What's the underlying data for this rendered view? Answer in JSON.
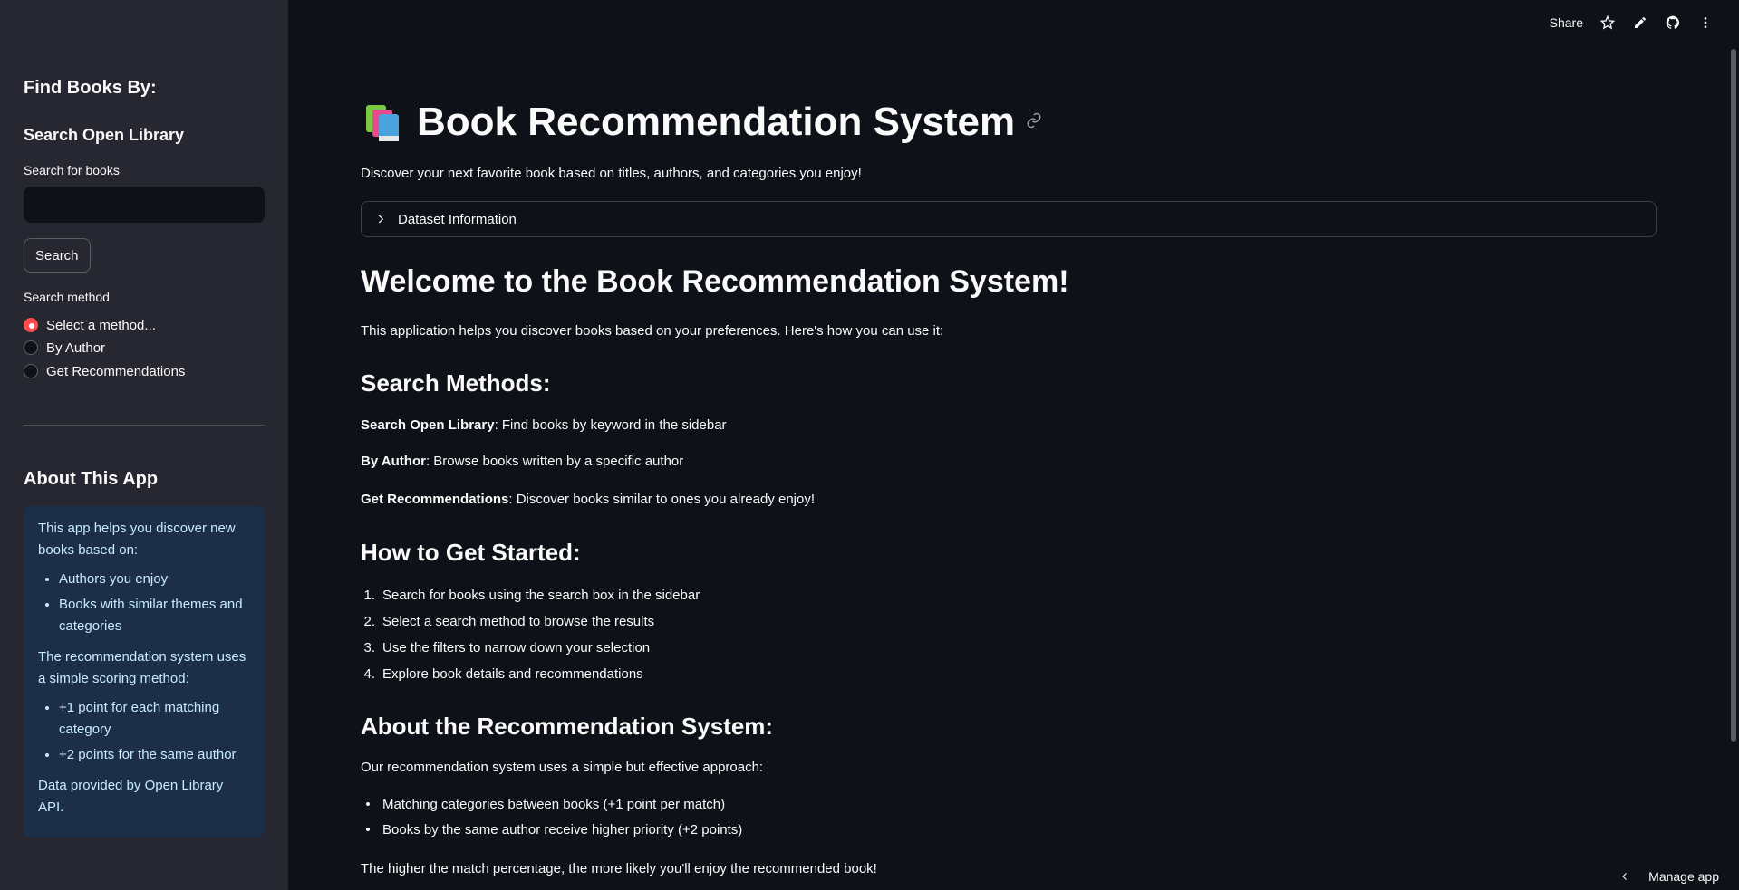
{
  "sidebar": {
    "heading": "Find Books By:",
    "search_heading": "Search Open Library",
    "search_label": "Search for books",
    "search_value": "",
    "search_button": "Search",
    "method_label": "Search method",
    "methods": [
      {
        "label": "Select a method...",
        "checked": true
      },
      {
        "label": "By Author",
        "checked": false
      },
      {
        "label": "Get Recommendations",
        "checked": false
      }
    ],
    "about_heading": "About This App",
    "about": {
      "intro": "This app helps you discover new books based on:",
      "bullets1": [
        "Authors you enjoy",
        "Books with similar themes and categories"
      ],
      "scoring": "The recommendation system uses a simple scoring method:",
      "bullets2": [
        "+1 point for each matching category",
        "+2 points for the same author"
      ],
      "footer": "Data provided by Open Library API."
    }
  },
  "toolbar": {
    "share": "Share",
    "icons": [
      "star-icon",
      "edit-icon",
      "github-icon",
      "more-icon"
    ]
  },
  "main": {
    "title": "Book Recommendation System",
    "subtitle": "Discover your next favorite book based on titles, authors, and categories you enjoy!",
    "expander": "Dataset Information",
    "welcome": "Welcome to the Book Recommendation System!",
    "welcome_text": "This application helps you discover books based on your preferences. Here's how you can use it:",
    "methods_heading": "Search Methods:",
    "methods": [
      {
        "bold": "Search Open Library",
        "rest": ": Find books by keyword in the sidebar"
      },
      {
        "bold": "By Author",
        "rest": ": Browse books written by a specific author"
      },
      {
        "bold": "Get Recommendations",
        "rest": ": Discover books similar to ones you already enjoy!"
      }
    ],
    "started_heading": "How to Get Started:",
    "steps": [
      "Search for books using the search box in the sidebar",
      "Select a search method to browse the results",
      "Use the filters to narrow down your selection",
      "Explore book details and recommendations"
    ],
    "about_heading": "About the Recommendation System:",
    "about_text": "Our recommendation system uses a simple but effective approach:",
    "about_bullets": [
      "Matching categories between books (+1 point per match)",
      "Books by the same author receive higher priority (+2 points)"
    ],
    "closing": "The higher the match percentage, the more likely you'll enjoy the recommended book!"
  },
  "manage_app": "Manage app",
  "colors": {
    "background": "#0e1117",
    "sidebar": "#262730",
    "accent": "#ff4b4b",
    "info_bg": "#1d2f47",
    "info_text": "#c7ebff"
  }
}
